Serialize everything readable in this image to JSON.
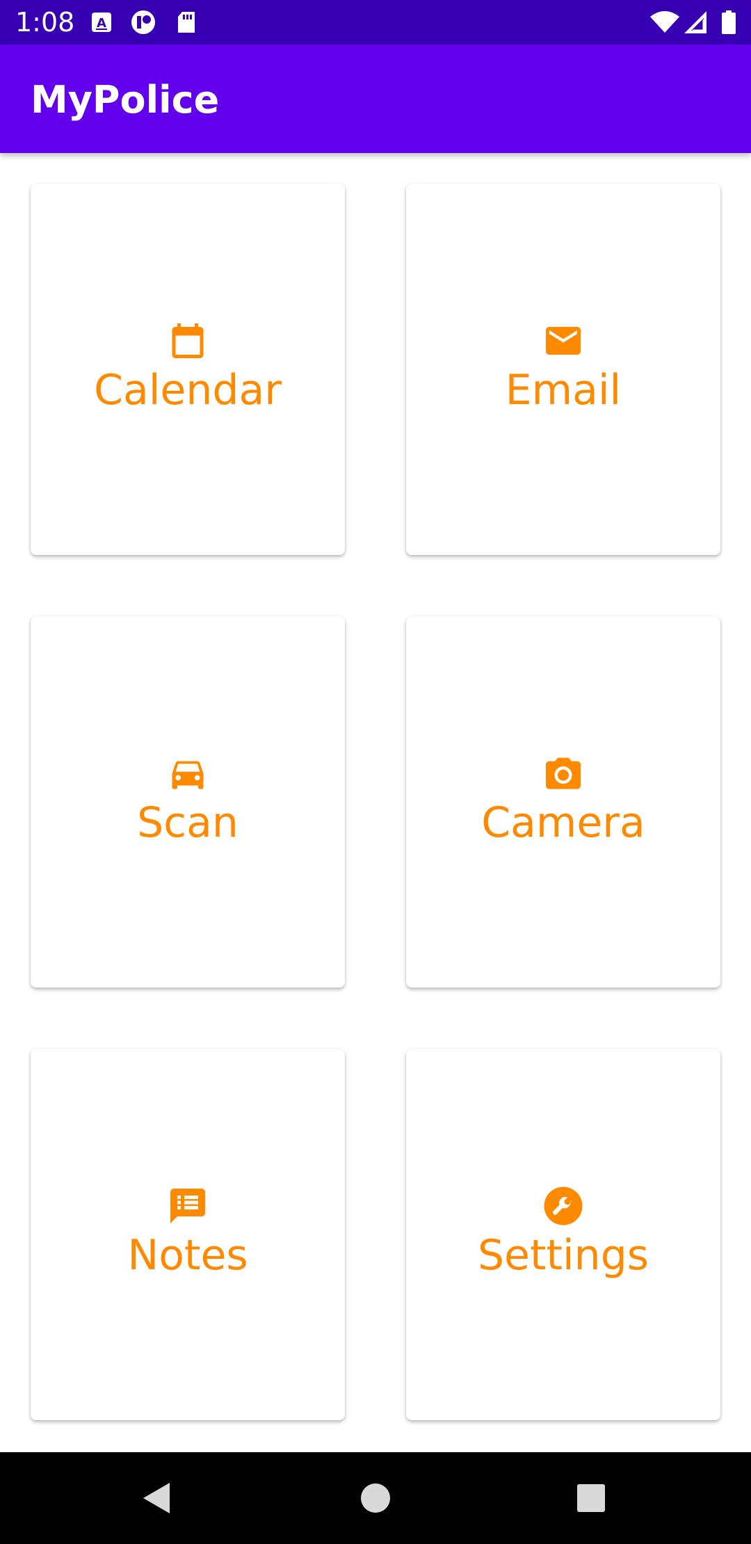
{
  "status_bar": {
    "time": "1:08",
    "icons": [
      "a11y-notification-icon",
      "app-notification-icon",
      "sd-card-icon",
      "wifi-icon",
      "cellular-signal-icon",
      "battery-icon"
    ]
  },
  "app_bar": {
    "title": "MyPolice"
  },
  "colors": {
    "status_bar": "#3700B3",
    "app_bar": "#6200EE",
    "accent": "#FF8A00",
    "card_bg": "#FFFFFF"
  },
  "tiles": [
    {
      "label": "Calendar",
      "icon": "calendar-icon"
    },
    {
      "label": "Email",
      "icon": "email-icon"
    },
    {
      "label": "Scan",
      "icon": "car-icon"
    },
    {
      "label": "Camera",
      "icon": "camera-icon"
    },
    {
      "label": "Notes",
      "icon": "notes-icon"
    },
    {
      "label": "Settings",
      "icon": "wrench-icon"
    }
  ],
  "nav_bar": {
    "buttons": [
      "back-icon",
      "home-icon",
      "recents-icon"
    ]
  }
}
